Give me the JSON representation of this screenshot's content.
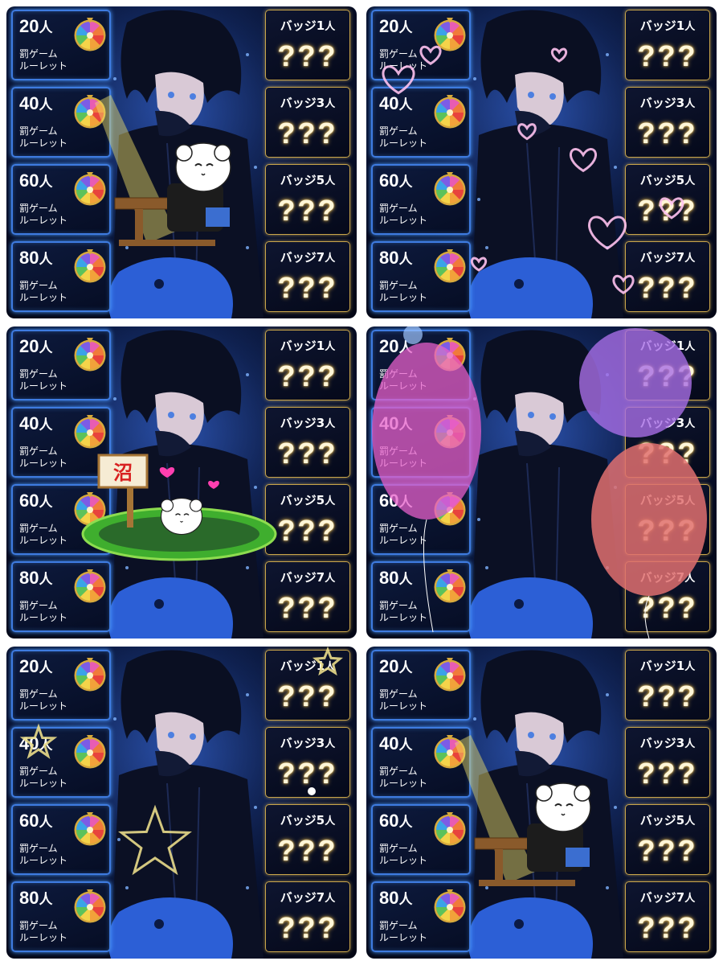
{
  "panels": [
    {
      "goals": [
        {
          "count": "20",
          "unit": "人",
          "label1": "罰ゲーム",
          "label2": "ルーレット"
        },
        {
          "count": "40",
          "unit": "人",
          "label1": "罰ゲーム",
          "label2": "ルーレット"
        },
        {
          "count": "60",
          "unit": "人",
          "label1": "罰ゲーム",
          "label2": "ルーレット"
        },
        {
          "count": "80",
          "unit": "人",
          "label1": "罰ゲーム",
          "label2": "ルーレット"
        }
      ],
      "badges": [
        {
          "title": "バッジ",
          "num": "1",
          "unit": "人",
          "marks": "???"
        },
        {
          "title": "バッジ",
          "num": "3",
          "unit": "人",
          "marks": "???"
        },
        {
          "title": "バッジ",
          "num": "5",
          "unit": "人",
          "marks": "???"
        },
        {
          "title": "バッジ",
          "num": "7",
          "unit": "人",
          "marks": "???"
        }
      ],
      "overlay": "spotlight-podium-sheep"
    },
    {
      "goals": [
        {
          "count": "20",
          "unit": "人",
          "label1": "罰ゲーム",
          "label2": "ルーレット"
        },
        {
          "count": "40",
          "unit": "人",
          "label1": "罰ゲーム",
          "label2": "ルーレット"
        },
        {
          "count": "60",
          "unit": "人",
          "label1": "罰ゲーム",
          "label2": "ルーレット"
        },
        {
          "count": "80",
          "unit": "人",
          "label1": "罰ゲーム",
          "label2": "ルーレット"
        }
      ],
      "badges": [
        {
          "title": "バッジ",
          "num": "1",
          "unit": "人",
          "marks": "???"
        },
        {
          "title": "バッジ",
          "num": "3",
          "unit": "人",
          "marks": "???"
        },
        {
          "title": "バッジ",
          "num": "5",
          "unit": "人",
          "marks": "???"
        },
        {
          "title": "バッジ",
          "num": "7",
          "unit": "人",
          "marks": "???"
        }
      ],
      "overlay": "hearts"
    },
    {
      "goals": [
        {
          "count": "20",
          "unit": "人",
          "label1": "罰ゲーム",
          "label2": "ルーレット"
        },
        {
          "count": "40",
          "unit": "人",
          "label1": "罰ゲーム",
          "label2": "ルーレット"
        },
        {
          "count": "60",
          "unit": "人",
          "label1": "罰ゲーム",
          "label2": "ルーレット"
        },
        {
          "count": "80",
          "unit": "人",
          "label1": "罰ゲーム",
          "label2": "ルーレット"
        }
      ],
      "badges": [
        {
          "title": "バッジ",
          "num": "1",
          "unit": "人",
          "marks": "???"
        },
        {
          "title": "バッジ",
          "num": "3",
          "unit": "人",
          "marks": "???"
        },
        {
          "title": "バッジ",
          "num": "5",
          "unit": "人",
          "marks": "???"
        },
        {
          "title": "バッジ",
          "num": "7",
          "unit": "人",
          "marks": "???"
        }
      ],
      "overlay": "swamp-sign-sheep",
      "sign_text": "沼"
    },
    {
      "goals": [
        {
          "count": "20",
          "unit": "人",
          "label1": "罰ゲーム",
          "label2": "ルーレット"
        },
        {
          "count": "40",
          "unit": "人",
          "label1": "罰ゲーム",
          "label2": "ルーレット"
        },
        {
          "count": "60",
          "unit": "人",
          "label1": "罰ゲーム",
          "label2": "ルーレット"
        },
        {
          "count": "80",
          "unit": "人",
          "label1": "罰ゲーム",
          "label2": "ルーレット"
        }
      ],
      "badges": [
        {
          "title": "バッジ",
          "num": "1",
          "unit": "人",
          "marks": "???"
        },
        {
          "title": "バッジ",
          "num": "3",
          "unit": "人",
          "marks": "???"
        },
        {
          "title": "バッジ",
          "num": "5",
          "unit": "人",
          "marks": "???"
        },
        {
          "title": "バッジ",
          "num": "7",
          "unit": "人",
          "marks": "???"
        }
      ],
      "overlay": "balloons"
    },
    {
      "goals": [
        {
          "count": "20",
          "unit": "人",
          "label1": "罰ゲーム",
          "label2": "ルーレット"
        },
        {
          "count": "40",
          "unit": "人",
          "label1": "罰ゲーム",
          "label2": "ルーレット"
        },
        {
          "count": "60",
          "unit": "人",
          "label1": "罰ゲーム",
          "label2": "ルーレット"
        },
        {
          "count": "80",
          "unit": "人",
          "label1": "罰ゲーム",
          "label2": "ルーレット"
        }
      ],
      "badges": [
        {
          "title": "バッジ",
          "num": "1",
          "unit": "人",
          "marks": "???"
        },
        {
          "title": "バッジ",
          "num": "3",
          "unit": "人",
          "marks": "???"
        },
        {
          "title": "バッジ",
          "num": "5",
          "unit": "人",
          "marks": "???"
        },
        {
          "title": "バッジ",
          "num": "7",
          "unit": "人",
          "marks": "???"
        }
      ],
      "overlay": "stars"
    },
    {
      "goals": [
        {
          "count": "20",
          "unit": "人",
          "label1": "罰ゲーム",
          "label2": "ルーレット"
        },
        {
          "count": "40",
          "unit": "人",
          "label1": "罰ゲーム",
          "label2": "ルーレット"
        },
        {
          "count": "60",
          "unit": "人",
          "label1": "罰ゲーム",
          "label2": "ルーレット"
        },
        {
          "count": "80",
          "unit": "人",
          "label1": "罰ゲーム",
          "label2": "ルーレット"
        }
      ],
      "badges": [
        {
          "title": "バッジ",
          "num": "1",
          "unit": "人",
          "marks": "???"
        },
        {
          "title": "バッジ",
          "num": "3",
          "unit": "人",
          "marks": "???"
        },
        {
          "title": "バッジ",
          "num": "5",
          "unit": "人",
          "marks": "???"
        },
        {
          "title": "バッジ",
          "num": "7",
          "unit": "人",
          "marks": "???"
        }
      ],
      "overlay": "spotlight-podium-sheep"
    }
  ],
  "colors": {
    "goal_border": "#3e7be0",
    "badge_border": "#c9a54a",
    "marks_glow": "#e2b54a",
    "background": "#0c1d4a"
  }
}
